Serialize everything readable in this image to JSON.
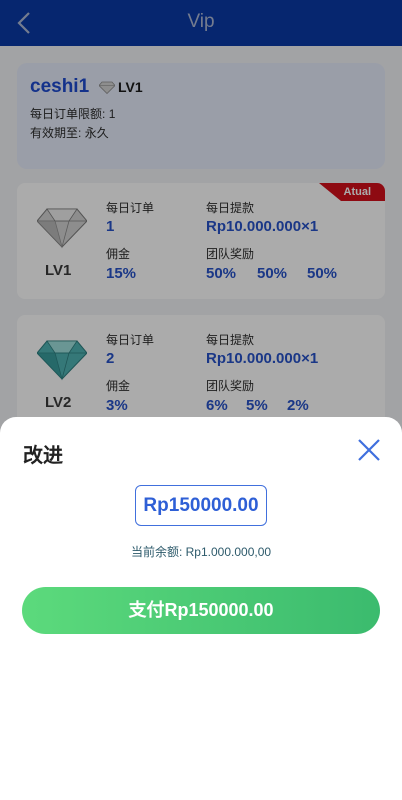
{
  "header": {
    "title": "Vip"
  },
  "user": {
    "name": "ceshi1",
    "level": "LV1",
    "daily_limit_label": "每日订单限额:",
    "daily_limit_value": "1",
    "validity_label": "有效期至:",
    "validity_value": "永久"
  },
  "levels": [
    {
      "level": "LV1",
      "badge": "Atual",
      "daily_orders_label": "每日订单",
      "daily_orders": "1",
      "daily_withdraw_label": "每日提款",
      "daily_withdraw": "Rp10.000.000×1",
      "commission_label": "佣金",
      "commission": "15%",
      "team_reward_label": "团队奖励",
      "team_rewards": [
        "50%",
        "50%",
        "50%"
      ],
      "gem_color": "#c9c9c9"
    },
    {
      "level": "LV2",
      "daily_orders_label": "每日订单",
      "daily_orders": "2",
      "daily_withdraw_label": "每日提款",
      "daily_withdraw": "Rp10.000.000×1",
      "commission_label": "佣金",
      "commission": "3%",
      "team_reward_label": "团队奖励",
      "team_rewards": [
        "6%",
        "5%",
        "2%"
      ],
      "gem_color": "#4fb3b3"
    }
  ],
  "modal": {
    "title": "改进",
    "amount": "Rp150000.00",
    "balance_label": "当前余额:",
    "balance_value": "Rp1.000.000,00",
    "pay_label": "支付Rp150000.00"
  },
  "icons": {
    "back": "chevron-left-icon",
    "close": "close-icon",
    "gem": "diamond-icon"
  },
  "colors": {
    "header": "#0a3aa6",
    "accent": "#2853c9",
    "pay_start": "#5cda7c",
    "pay_end": "#3bbb6e",
    "badge": "#d40f1c"
  }
}
